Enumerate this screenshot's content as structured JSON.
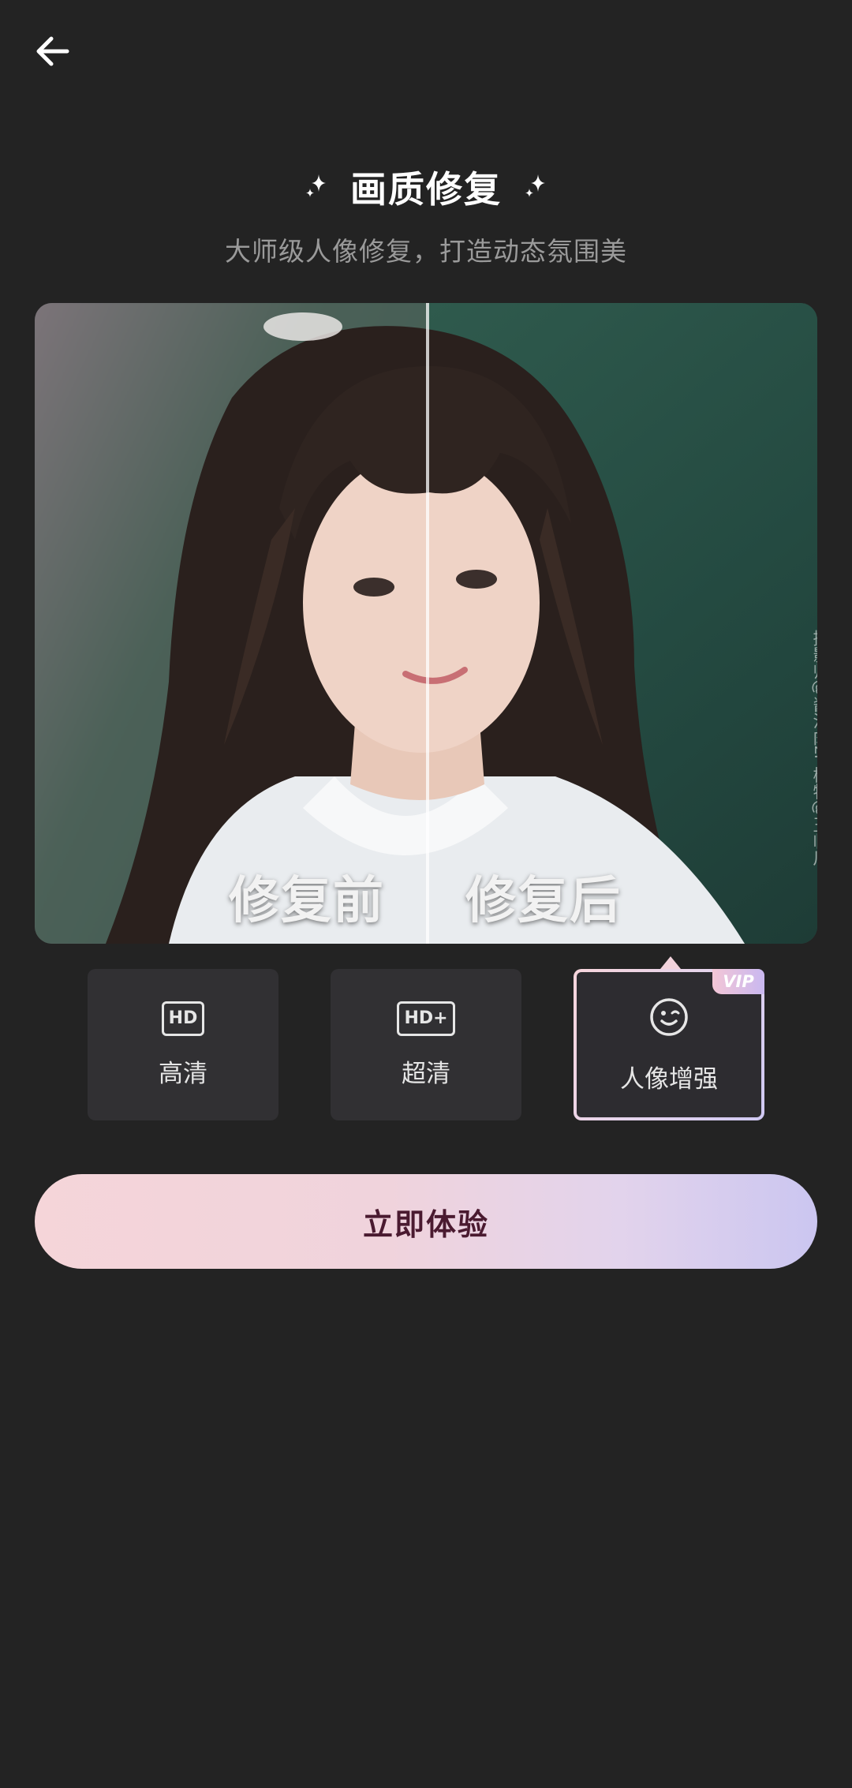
{
  "header": {
    "back_icon": "arrow-left-icon",
    "title": "画质修复",
    "title_icon": "sparkle-icon",
    "subtitle": "大师级人像修复，打造动态氛围美"
  },
  "preview": {
    "before_label": "修复前",
    "after_label": "修复后",
    "watermark": "摄影师@酱汁肉zr 模特@王临川"
  },
  "options": [
    {
      "label": "高清",
      "icon_text": "HD",
      "icon": "hd-icon"
    },
    {
      "label": "超清",
      "icon_text": "HD+",
      "icon": "hd-plus-icon"
    },
    {
      "label": "人像增强",
      "icon": "smile-wink-icon",
      "badge": "VIP",
      "selected": true
    }
  ],
  "cta": {
    "label": "立即体验"
  },
  "colors": {
    "background": "#232323",
    "option_bg": "#313033",
    "cta_gradient_start": "#f5d5d9",
    "cta_gradient_end": "#cbc6f0",
    "cta_text": "#4a1a30"
  }
}
